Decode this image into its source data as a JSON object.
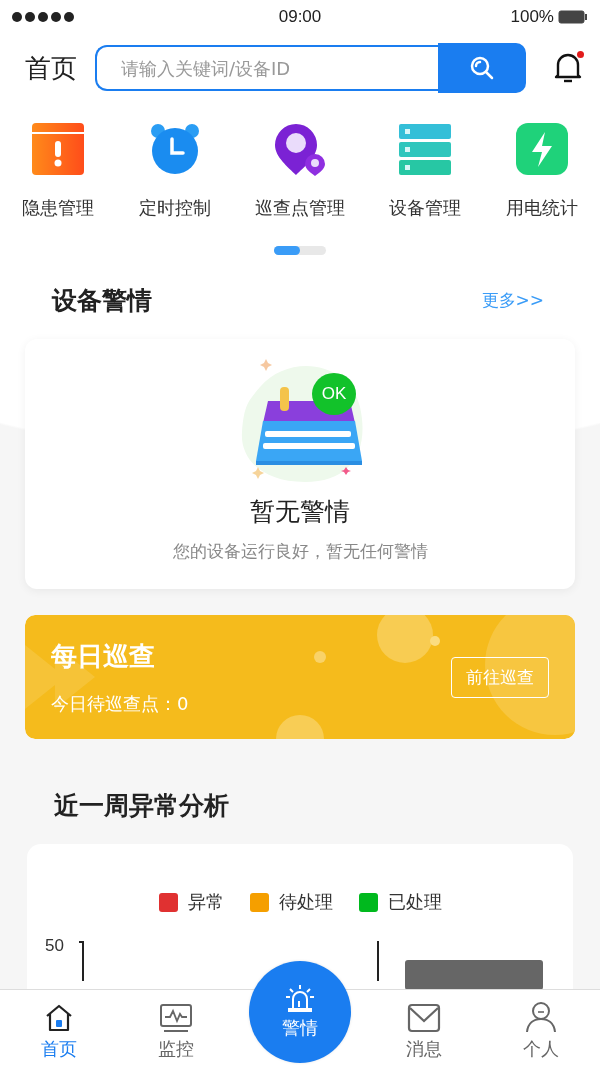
{
  "status_bar": {
    "time": "09:00",
    "battery": "100%"
  },
  "header": {
    "title": "首页",
    "search": {
      "placeholder": "请输入关键词/设备ID"
    },
    "notification_badge": true
  },
  "shortcuts": [
    {
      "label": "隐患管理",
      "kind": "warning"
    },
    {
      "label": "定时控制",
      "kind": "clock"
    },
    {
      "label": "巡查点管理",
      "kind": "pin"
    },
    {
      "label": "设备管理",
      "kind": "server"
    },
    {
      "label": "用电统计",
      "kind": "power"
    }
  ],
  "pager": {
    "level": 0.5
  },
  "alerts": {
    "title": "设备警情",
    "more": "更多>>",
    "empty_title": "暂无警情",
    "empty_text": "您的设备运行良好，暂无任何警情",
    "badge": "OK"
  },
  "patrol": {
    "title": "每日巡查",
    "subtitle": "今日待巡查点：0",
    "button": "前往巡查"
  },
  "analysis": {
    "title": "近一周异常分析",
    "legend": [
      {
        "label": "异常",
        "color": "#e03131"
      },
      {
        "label": "待处理",
        "color": "#f59f00"
      },
      {
        "label": "已处理",
        "color": "#00b91e"
      }
    ],
    "y_tick": "50"
  },
  "tab_bar": [
    {
      "label": "首页",
      "kind": "home",
      "selected": true
    },
    {
      "label": "监控",
      "kind": "monitor",
      "selected": false
    },
    {
      "label": "警情",
      "kind": "alarm",
      "selected": false
    },
    {
      "label": "消息",
      "kind": "mail",
      "selected": false
    },
    {
      "label": "个人",
      "kind": "person",
      "selected": false
    }
  ]
}
